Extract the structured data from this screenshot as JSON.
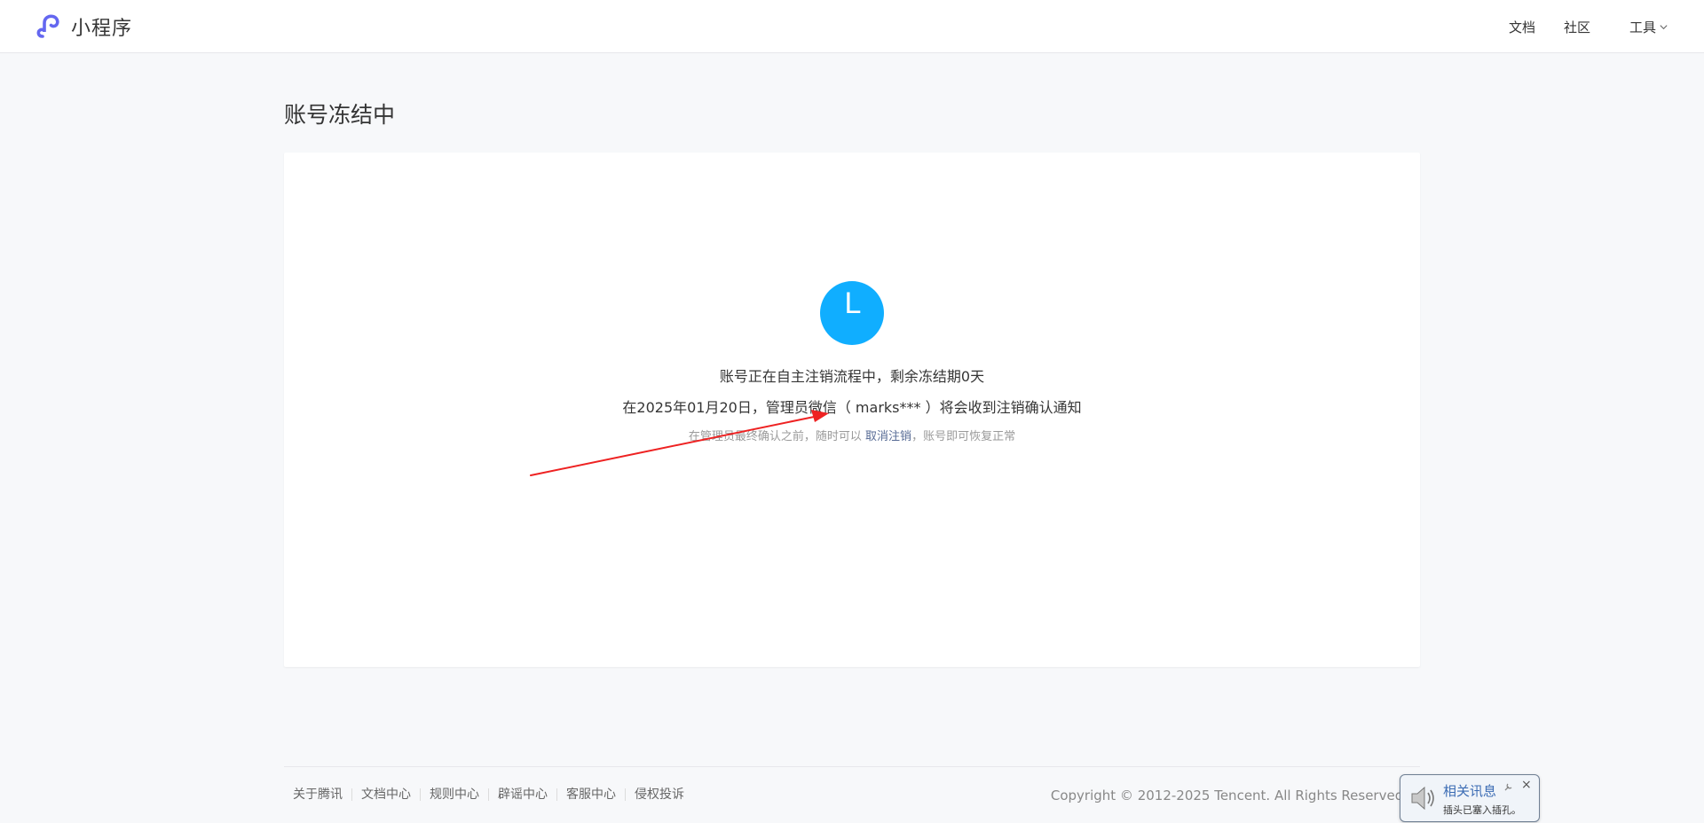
{
  "header": {
    "brand_name": "小程序",
    "nav": {
      "docs": "文档",
      "community": "社区",
      "tools": "工具"
    }
  },
  "page": {
    "title": "账号冻结中"
  },
  "status": {
    "icon_letter": "L",
    "line1": "账号正在自主注销流程中，剩余冻结期0天",
    "line2": "在2025年01月20日，管理员微信（ marks*** ）将会收到注销确认通知",
    "line3_before": "在管理员最终确认之前，随时可以 ",
    "cancel_link": "取消注销",
    "line3_after": "，账号即可恢复正常"
  },
  "footer": {
    "links": [
      "关于腾讯",
      "文档中心",
      "规则中心",
      "辟谣中心",
      "客服中心",
      "侵权投诉"
    ],
    "copyright": "Copyright © 2012-2025 Tencent. All Rights Reserved."
  },
  "notification": {
    "title": "相关讯息",
    "subtitle": "插头已塞入插孔。",
    "close": "×"
  },
  "colors": {
    "brand": "#6467f0",
    "accent_blue": "#10aeff",
    "link": "#576b95",
    "annotation_arrow": "#ee2222"
  }
}
